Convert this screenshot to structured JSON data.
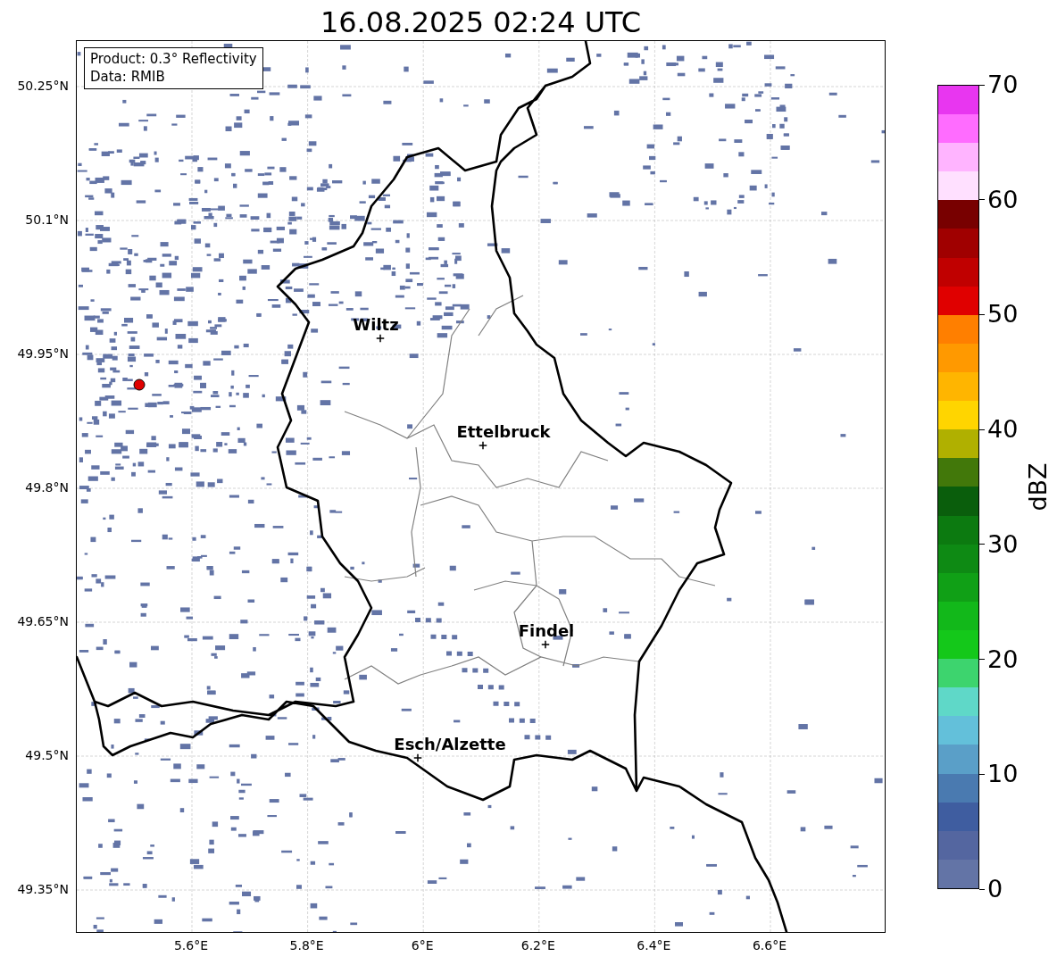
{
  "title": "16.08.2025 02:24 UTC",
  "info_box": {
    "lines": [
      "Product: 0.3° Reflectivity",
      "Data: RMIB"
    ]
  },
  "map": {
    "cities": [
      {
        "name": "Wiltz"
      },
      {
        "name": "Ettelbruck"
      },
      {
        "name": "Findel"
      },
      {
        "name": "Esch/Alzette"
      }
    ],
    "xticks": [
      "5.6°E",
      "5.8°E",
      "6°E",
      "6.2°E",
      "6.4°E",
      "6.6°E"
    ],
    "yticks": [
      "50.25°N",
      "50.1°N",
      "49.95°N",
      "49.8°N",
      "49.65°N",
      "49.5°N",
      "49.35°N"
    ]
  },
  "colorbar": {
    "label": "dBZ",
    "ticks": [
      "70",
      "60",
      "50",
      "40",
      "30",
      "20",
      "10",
      "0"
    ],
    "segments": [
      {
        "color": "#6374a6"
      },
      {
        "color": "#5466a0"
      },
      {
        "color": "#3f5da0"
      },
      {
        "color": "#4a7ab0"
      },
      {
        "color": "#5a9fc8"
      },
      {
        "color": "#63c0da"
      },
      {
        "color": "#5fd8c8"
      },
      {
        "color": "#3dd46e"
      },
      {
        "color": "#14c81a"
      },
      {
        "color": "#12b81a"
      },
      {
        "color": "#10a016"
      },
      {
        "color": "#0e8a14"
      },
      {
        "color": "#0c7a10"
      },
      {
        "color": "#0a5e0c"
      },
      {
        "color": "#42780a"
      },
      {
        "color": "#b0b000"
      },
      {
        "color": "#ffd500"
      },
      {
        "color": "#ffb500"
      },
      {
        "color": "#ff9900"
      },
      {
        "color": "#ff7f00"
      },
      {
        "color": "#e00000"
      },
      {
        "color": "#c00000"
      },
      {
        "color": "#a00000"
      },
      {
        "color": "#780000"
      },
      {
        "color": "#ffe0ff"
      },
      {
        "color": "#ffb4ff"
      },
      {
        "color": "#ff6cff"
      },
      {
        "color": "#e836f0"
      }
    ]
  }
}
